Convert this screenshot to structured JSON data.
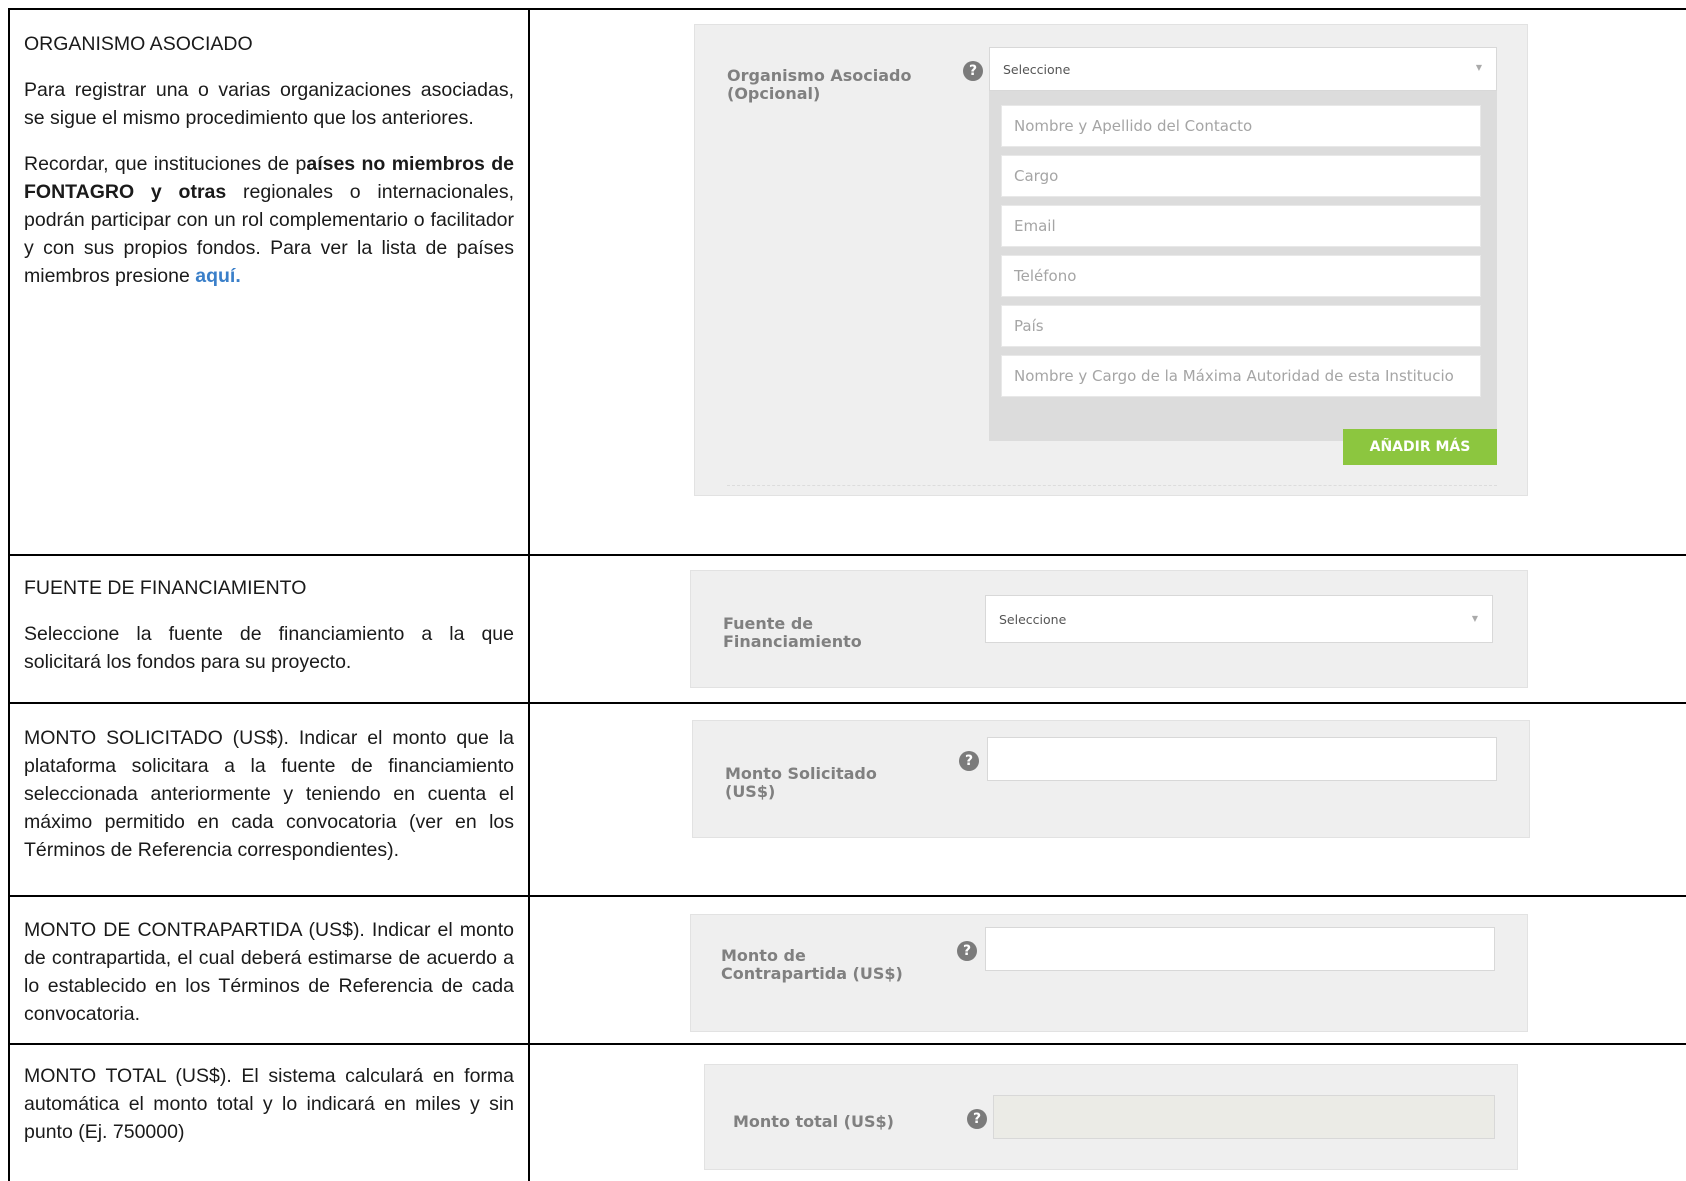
{
  "rows": {
    "organismo": {
      "heading": "ORGANISMO ASOCIADO",
      "para1": "Para registrar una o varias organizaciones asociadas, se sigue el mismo procedimiento que los anteriores.",
      "para2_a": "Recordar, que instituciones de p",
      "para2_b": "aíses no miembros de FONTAGRO y otras",
      "para2_c": " regionales o internacionales, podrán participar con un rol complementario o facilitador y con sus propios fondos. Para ver la lista de países miembros presione ",
      "link": "aquí."
    },
    "fuente": {
      "heading": "FUENTE DE FINANCIAMIENTO",
      "para": "Seleccione la fuente de financiamiento a la que solicitará los fondos para su proyecto."
    },
    "monto_solicitado": {
      "para": "MONTO SOLICITADO (US$). Indicar el monto que la plataforma solicitara a la fuente de financiamiento seleccionada anteriormente y teniendo en cuenta el máximo permitido en cada convocatoria (ver en los Términos de Referencia correspondientes)."
    },
    "monto_contrapartida": {
      "para": "MONTO DE CONTRAPARTIDA (US$). Indicar el monto de contrapartida, el cual deberá estimarse de acuerdo a lo establecido en los Términos de Referencia de cada convocatoria."
    },
    "monto_total": {
      "para": "MONTO TOTAL (US$). El sistema calculará en forma automática el monto total y lo indicará en miles y sin punto (Ej. 750000)"
    }
  },
  "forms": {
    "organismo": {
      "label": "Organismo Asociado (Opcional)",
      "select_value": "Seleccione",
      "fields": [
        "Nombre y Apellido del Contacto",
        "Cargo",
        "Email",
        "Teléfono",
        "País",
        "Nombre y Cargo de la Máxima Autoridad de esta Institucio"
      ],
      "button": "AÑADIR MÁS"
    },
    "fuente": {
      "label": "Fuente de Financiamiento",
      "select_value": "Seleccione"
    },
    "monto_solicitado": {
      "label": "Monto Solicitado (US$)"
    },
    "monto_contrapartida": {
      "label": "Monto de Contrapartida (US$)"
    },
    "monto_total": {
      "label": "Monto total (US$)"
    }
  },
  "icons": {
    "help": "question-circle-icon",
    "caret": "caret-down-icon"
  },
  "colors": {
    "button": "#8cc63f",
    "panel": "#efefef",
    "link": "#3a7fc9"
  }
}
